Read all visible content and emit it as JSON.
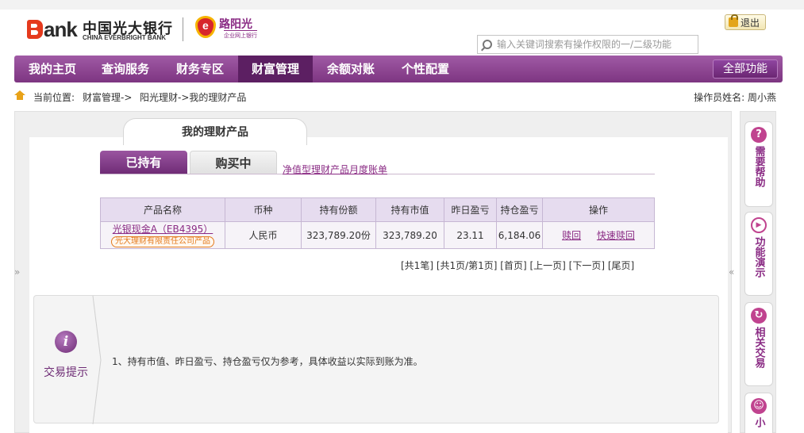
{
  "header": {
    "logo_mark": "B",
    "logo_word": "ank",
    "bank_name_cn": "中国光大银行",
    "bank_name_en": "CHINA EVERBRIGHT BANK",
    "sunshine_title": "路阳光",
    "sunshine_sub": "企业网上银行",
    "logout_label": "退出",
    "search_placeholder": "输入关键词搜索有操作权限的一/二级功能"
  },
  "nav": {
    "items": [
      {
        "label": "我的主页"
      },
      {
        "label": "查询服务"
      },
      {
        "label": "财务专区"
      },
      {
        "label": "财富管理"
      },
      {
        "label": "余额对账"
      },
      {
        "label": "个性配置"
      }
    ],
    "active_index": 3,
    "all_functions_label": "全部功能"
  },
  "breadcrumb": {
    "prefix": "当前位置:",
    "items": [
      "财富管理->",
      "阳光理财->我的理财产品"
    ],
    "operator_label": "操作员姓名:",
    "operator_name": "周小燕"
  },
  "panel": {
    "title": "我的理财产品",
    "collapse_left": "»",
    "collapse_right": "«",
    "tabs": [
      {
        "label": "已持有",
        "active": true
      },
      {
        "label": "购买中",
        "active": false
      }
    ],
    "statement_link": "净值型理财产品月度账单"
  },
  "table": {
    "headers": [
      "产品名称",
      "币种",
      "持有份额",
      "持有市值",
      "昨日盈亏",
      "持仓盈亏",
      "操作"
    ],
    "rows": [
      {
        "product_name": "光银现金A（EB4395）",
        "issuer": "光大理财有限责任公司产品",
        "currency": "人民币",
        "shares": "323,789.20份",
        "market_value": "323,789.20",
        "yesterday_pl": "23.11",
        "position_pl": "6,184.06",
        "actions": [
          "赎回",
          "快速赎回"
        ]
      }
    ]
  },
  "pager": {
    "text": "[共1笔] [共1页/第1页] [首页] [上一页] [下一页] [尾页]"
  },
  "tips": {
    "title": "交易提示",
    "icon_glyph": "i",
    "text": "1、持有市值、昨日盈亏、持仓盈亏仅为参考，具体收益以实际到账为准。"
  },
  "rail": {
    "items": [
      {
        "label": "需要帮助",
        "icon": "question-icon",
        "glyph": "?",
        "color": "#c0438f"
      },
      {
        "label": "功能演示",
        "icon": "play-icon",
        "glyph": "▶",
        "color": "#c0438f"
      },
      {
        "label": "相关交易",
        "icon": "refresh-icon",
        "glyph": "↻",
        "color": "#c0438f"
      },
      {
        "label": "小",
        "icon": "smile-icon",
        "glyph": "☺",
        "color": "#c0438f"
      }
    ]
  },
  "colors": {
    "brand_purple": "#8a2b84",
    "nav_active": "#5c1f62",
    "accent_orange": "#e47b1f",
    "logo_red": "#e53a1d"
  }
}
